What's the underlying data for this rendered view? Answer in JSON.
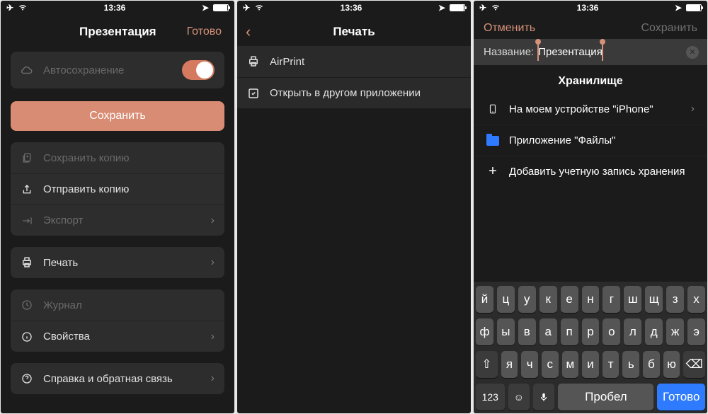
{
  "status": {
    "time": "13:36"
  },
  "screen1": {
    "title": "Презентация",
    "done": "Готово",
    "autosave": "Автосохранение",
    "save": "Сохранить",
    "saveCopy": "Сохранить копию",
    "sendCopy": "Отправить копию",
    "export": "Экспорт",
    "print": "Печать",
    "journal": "Журнал",
    "properties": "Свойства",
    "help": "Справка и обратная связь"
  },
  "screen2": {
    "title": "Печать",
    "airprint": "AirPrint",
    "openIn": "Открыть в другом приложении"
  },
  "screen3": {
    "cancel": "Отменить",
    "save": "Сохранить",
    "nameLabel": "Название:",
    "nameValue": "Презентация",
    "storageTitle": "Хранилище",
    "onDevice": "На моем устройстве \"iPhone\"",
    "filesApp": "Приложение \"Файлы\"",
    "addAccount": "Добавить учетную запись хранения"
  },
  "keyboard": {
    "row1": [
      "й",
      "ц",
      "у",
      "к",
      "е",
      "н",
      "г",
      "ш",
      "щ",
      "з",
      "х"
    ],
    "row2": [
      "ф",
      "ы",
      "в",
      "а",
      "п",
      "р",
      "о",
      "л",
      "д",
      "ж",
      "э"
    ],
    "row3": [
      "я",
      "ч",
      "с",
      "м",
      "и",
      "т",
      "ь",
      "б",
      "ю"
    ],
    "numKey": "123",
    "space": "Пробел",
    "enter": "Готово"
  }
}
